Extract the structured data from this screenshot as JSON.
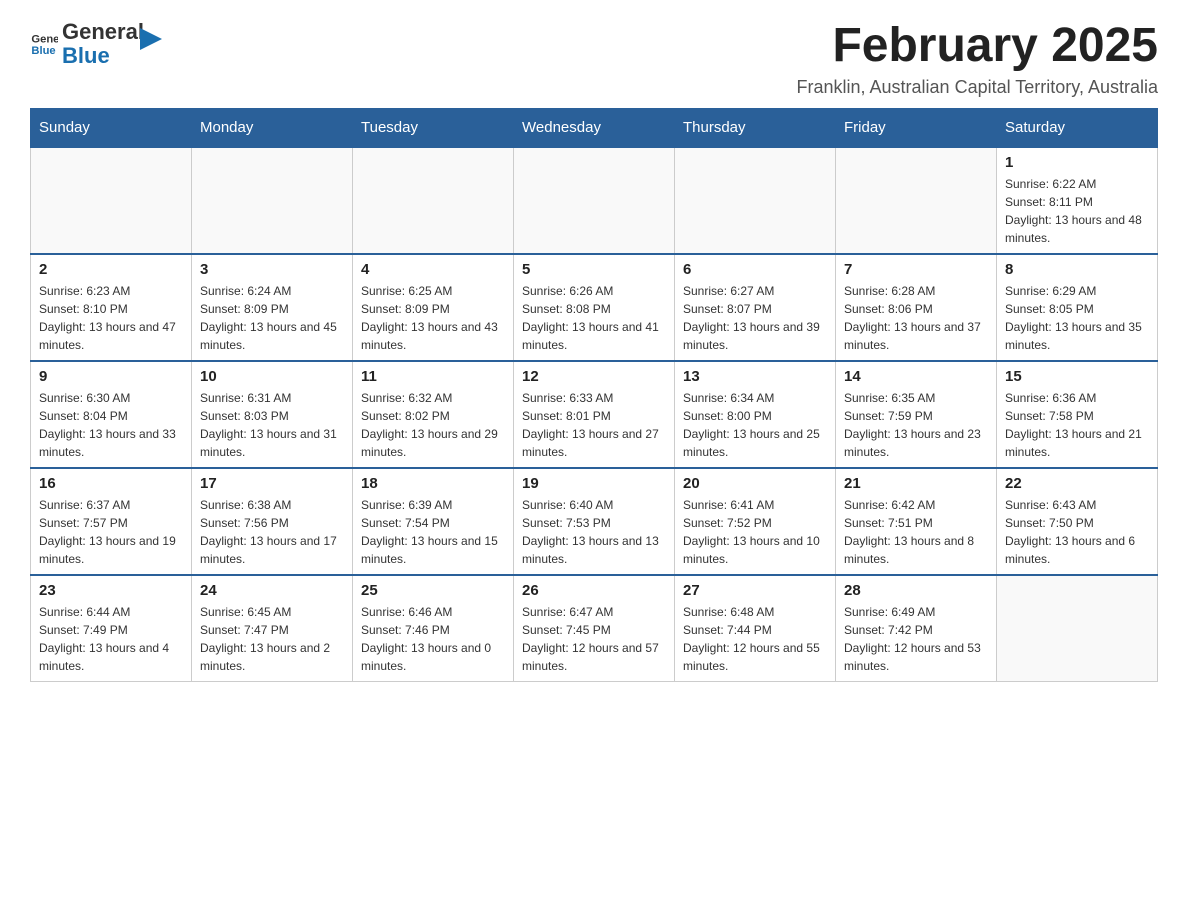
{
  "header": {
    "logo_general": "General",
    "logo_blue": "Blue",
    "month_title": "February 2025",
    "location": "Franklin, Australian Capital Territory, Australia"
  },
  "days_of_week": [
    "Sunday",
    "Monday",
    "Tuesday",
    "Wednesday",
    "Thursday",
    "Friday",
    "Saturday"
  ],
  "weeks": [
    [
      {
        "day": "",
        "info": ""
      },
      {
        "day": "",
        "info": ""
      },
      {
        "day": "",
        "info": ""
      },
      {
        "day": "",
        "info": ""
      },
      {
        "day": "",
        "info": ""
      },
      {
        "day": "",
        "info": ""
      },
      {
        "day": "1",
        "info": "Sunrise: 6:22 AM\nSunset: 8:11 PM\nDaylight: 13 hours and 48 minutes."
      }
    ],
    [
      {
        "day": "2",
        "info": "Sunrise: 6:23 AM\nSunset: 8:10 PM\nDaylight: 13 hours and 47 minutes."
      },
      {
        "day": "3",
        "info": "Sunrise: 6:24 AM\nSunset: 8:09 PM\nDaylight: 13 hours and 45 minutes."
      },
      {
        "day": "4",
        "info": "Sunrise: 6:25 AM\nSunset: 8:09 PM\nDaylight: 13 hours and 43 minutes."
      },
      {
        "day": "5",
        "info": "Sunrise: 6:26 AM\nSunset: 8:08 PM\nDaylight: 13 hours and 41 minutes."
      },
      {
        "day": "6",
        "info": "Sunrise: 6:27 AM\nSunset: 8:07 PM\nDaylight: 13 hours and 39 minutes."
      },
      {
        "day": "7",
        "info": "Sunrise: 6:28 AM\nSunset: 8:06 PM\nDaylight: 13 hours and 37 minutes."
      },
      {
        "day": "8",
        "info": "Sunrise: 6:29 AM\nSunset: 8:05 PM\nDaylight: 13 hours and 35 minutes."
      }
    ],
    [
      {
        "day": "9",
        "info": "Sunrise: 6:30 AM\nSunset: 8:04 PM\nDaylight: 13 hours and 33 minutes."
      },
      {
        "day": "10",
        "info": "Sunrise: 6:31 AM\nSunset: 8:03 PM\nDaylight: 13 hours and 31 minutes."
      },
      {
        "day": "11",
        "info": "Sunrise: 6:32 AM\nSunset: 8:02 PM\nDaylight: 13 hours and 29 minutes."
      },
      {
        "day": "12",
        "info": "Sunrise: 6:33 AM\nSunset: 8:01 PM\nDaylight: 13 hours and 27 minutes."
      },
      {
        "day": "13",
        "info": "Sunrise: 6:34 AM\nSunset: 8:00 PM\nDaylight: 13 hours and 25 minutes."
      },
      {
        "day": "14",
        "info": "Sunrise: 6:35 AM\nSunset: 7:59 PM\nDaylight: 13 hours and 23 minutes."
      },
      {
        "day": "15",
        "info": "Sunrise: 6:36 AM\nSunset: 7:58 PM\nDaylight: 13 hours and 21 minutes."
      }
    ],
    [
      {
        "day": "16",
        "info": "Sunrise: 6:37 AM\nSunset: 7:57 PM\nDaylight: 13 hours and 19 minutes."
      },
      {
        "day": "17",
        "info": "Sunrise: 6:38 AM\nSunset: 7:56 PM\nDaylight: 13 hours and 17 minutes."
      },
      {
        "day": "18",
        "info": "Sunrise: 6:39 AM\nSunset: 7:54 PM\nDaylight: 13 hours and 15 minutes."
      },
      {
        "day": "19",
        "info": "Sunrise: 6:40 AM\nSunset: 7:53 PM\nDaylight: 13 hours and 13 minutes."
      },
      {
        "day": "20",
        "info": "Sunrise: 6:41 AM\nSunset: 7:52 PM\nDaylight: 13 hours and 10 minutes."
      },
      {
        "day": "21",
        "info": "Sunrise: 6:42 AM\nSunset: 7:51 PM\nDaylight: 13 hours and 8 minutes."
      },
      {
        "day": "22",
        "info": "Sunrise: 6:43 AM\nSunset: 7:50 PM\nDaylight: 13 hours and 6 minutes."
      }
    ],
    [
      {
        "day": "23",
        "info": "Sunrise: 6:44 AM\nSunset: 7:49 PM\nDaylight: 13 hours and 4 minutes."
      },
      {
        "day": "24",
        "info": "Sunrise: 6:45 AM\nSunset: 7:47 PM\nDaylight: 13 hours and 2 minutes."
      },
      {
        "day": "25",
        "info": "Sunrise: 6:46 AM\nSunset: 7:46 PM\nDaylight: 13 hours and 0 minutes."
      },
      {
        "day": "26",
        "info": "Sunrise: 6:47 AM\nSunset: 7:45 PM\nDaylight: 12 hours and 57 minutes."
      },
      {
        "day": "27",
        "info": "Sunrise: 6:48 AM\nSunset: 7:44 PM\nDaylight: 12 hours and 55 minutes."
      },
      {
        "day": "28",
        "info": "Sunrise: 6:49 AM\nSunset: 7:42 PM\nDaylight: 12 hours and 53 minutes."
      },
      {
        "day": "",
        "info": ""
      }
    ]
  ]
}
